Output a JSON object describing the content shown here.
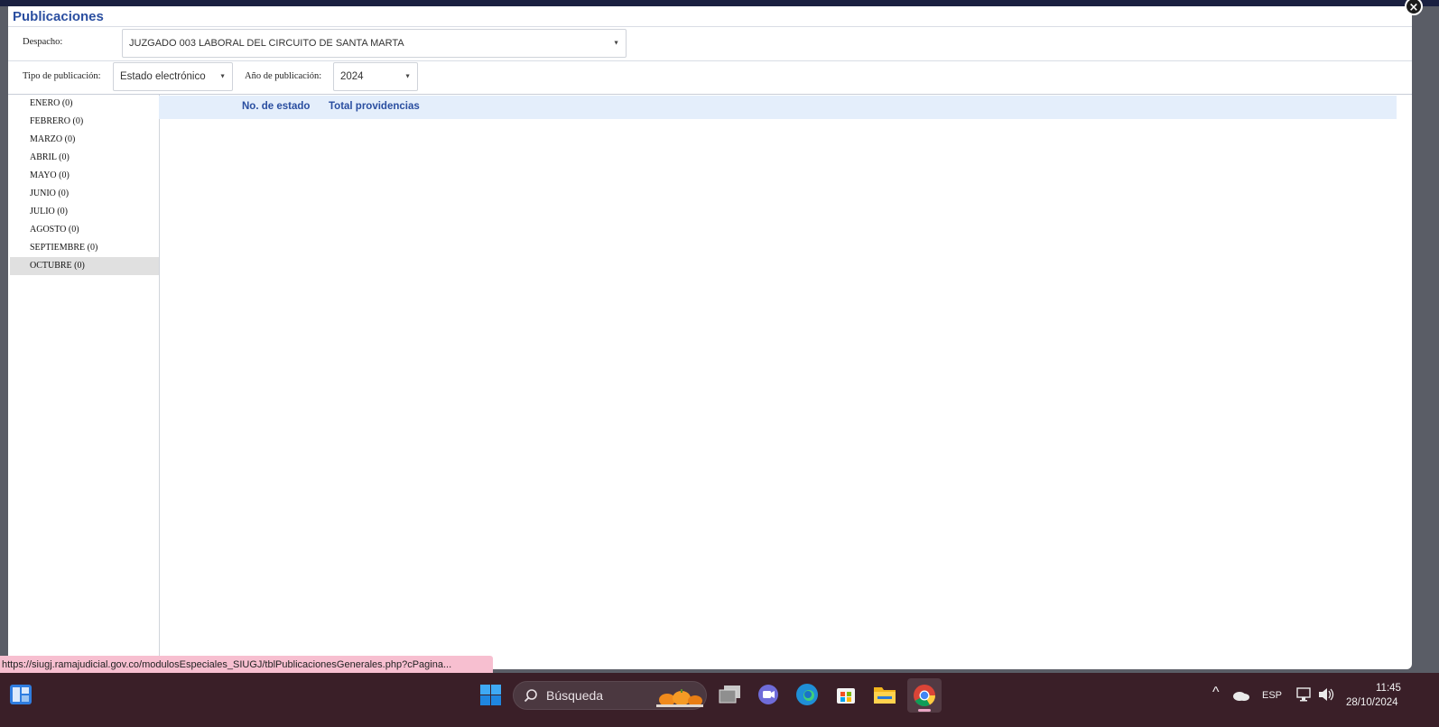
{
  "modal": {
    "title": "Publicaciones",
    "close_glyph": "×",
    "despacho_label": "Despacho:",
    "despacho_value": "JUZGADO 003 LABORAL DEL CIRCUITO DE SANTA MARTA",
    "tipo_label": "Tipo de publicación:",
    "tipo_value": "Estado electrónico",
    "anio_label": "Año de publicación:",
    "anio_value": "2024",
    "caret": "▼"
  },
  "sidebar": {
    "months": [
      {
        "label": "ENERO (0)",
        "selected": false
      },
      {
        "label": "FEBRERO (0)",
        "selected": false
      },
      {
        "label": "MARZO (0)",
        "selected": false
      },
      {
        "label": "ABRIL (0)",
        "selected": false
      },
      {
        "label": "MAYO (0)",
        "selected": false
      },
      {
        "label": "JUNIO (0)",
        "selected": false
      },
      {
        "label": "JULIO (0)",
        "selected": false
      },
      {
        "label": "AGOSTO (0)",
        "selected": false
      },
      {
        "label": "SEPTIEMBRE (0)",
        "selected": false
      },
      {
        "label": "OCTUBRE (0)",
        "selected": true
      }
    ]
  },
  "grid": {
    "col_estado": "No. de estado",
    "col_total": "Total providencias"
  },
  "status_url": "https://siugj.ramajudicial.gov.co/modulosEspeciales_SIUGJ/tblPublicacionesGenerales.php?cPagina...",
  "taskbar": {
    "search_placeholder": "Búsqueda",
    "lang": "ESP",
    "time": "11:45",
    "date": "28/10/2024",
    "tray_up": "^"
  },
  "colors": {
    "accent": "#2a4ea0",
    "header_bg": "#e4eefb",
    "selected_row": "#e0e0e0",
    "taskbar": "#3a1f28",
    "status_bar": "#f7bfd0"
  }
}
